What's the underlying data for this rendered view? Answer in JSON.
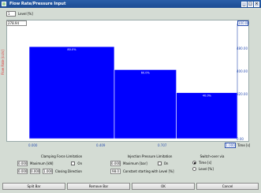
{
  "window": {
    "title": "Flow Rate/Pressure Input",
    "controls": [
      "_",
      "□",
      "×"
    ]
  },
  "selector": {
    "value": "1",
    "label": "Level [%]"
  },
  "chart": {
    "y_label": "Flow Rate [cc/s]",
    "y_max_box": "278.94",
    "right_max_box": "100.00",
    "right_ticks": [
      "480.00",
      "400.00",
      "320.00",
      "0.00"
    ],
    "x_ticks": [
      "0.000",
      "0.409",
      "0.707"
    ],
    "x_max_box": "1.000",
    "x_unit": "Time [s]",
    "bar_label_color": "#ffffff",
    "bar_color": "#0000ff"
  },
  "chart_data": {
    "type": "bar",
    "x_edges": [
      0.0,
      0.409,
      0.707,
      1.0
    ],
    "values": [
      80.0,
      60.0,
      40.0
    ],
    "labels": [
      "80.0%",
      "60.0%",
      "40.0%"
    ],
    "ylim": [
      0,
      100
    ]
  },
  "clamp": {
    "title": "Clamping Force Limitation",
    "b1": "0.000",
    "max_label": "Maximum [kN]",
    "on_label": "On",
    "b2": "0.000",
    "b3": "0.000",
    "b4": "1.000",
    "closing_label": "Closing Direction"
  },
  "inject": {
    "title": "Injection Pressure Limitation",
    "b1": "0.000",
    "max_label": "Maximum [bar]",
    "on_label": "On",
    "b2": "98.0",
    "const_label": "Constant starting with Level [%]"
  },
  "switch": {
    "title": "Switch-over via",
    "opt1": "Time [s]",
    "opt2": "Level [%]"
  },
  "buttons": {
    "split": "Split Bar",
    "remove": "Remove Bar",
    "ok": "OK",
    "cancel": "Cancel"
  }
}
